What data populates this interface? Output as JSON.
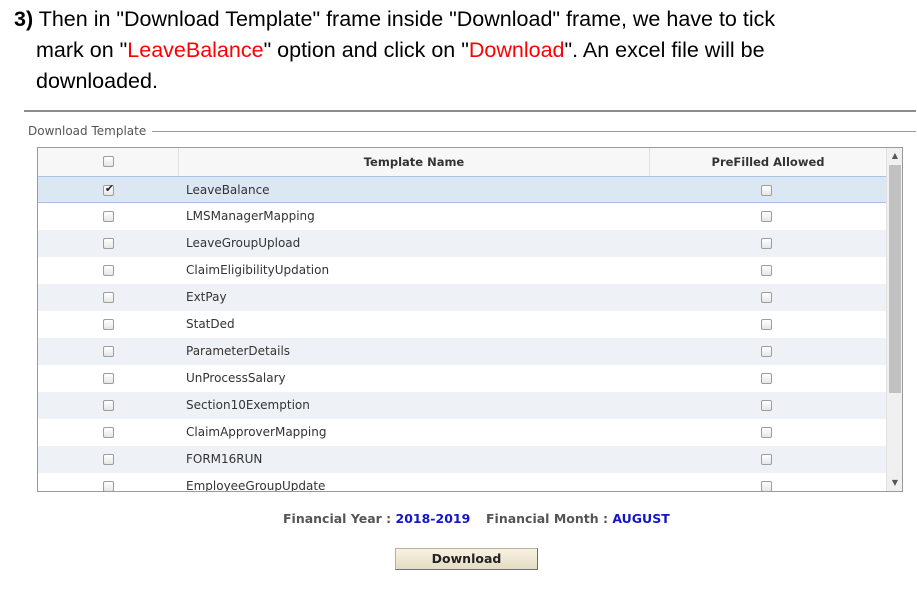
{
  "instruction": {
    "step_number": "3)",
    "line1": " Then in \"Download Template\" frame inside \"Download\" frame, we have to tick",
    "line2_a": "mark on \"",
    "line2_red1": "LeaveBalance",
    "line2_b": "\" option and click on \"",
    "line2_red2": "Download",
    "line2_c": "\". An excel file will be",
    "line3": "downloaded."
  },
  "frame": {
    "legend": "Download Template"
  },
  "table": {
    "header_template": "Template Name",
    "header_prefilled": "PreFilled Allowed",
    "rows": [
      {
        "name": "LeaveBalance",
        "checked": true,
        "prefilled": false
      },
      {
        "name": "LMSManagerMapping",
        "checked": false,
        "prefilled": false
      },
      {
        "name": "LeaveGroupUpload",
        "checked": false,
        "prefilled": false
      },
      {
        "name": "ClaimEligibilityUpdation",
        "checked": false,
        "prefilled": false
      },
      {
        "name": "ExtPay",
        "checked": false,
        "prefilled": false
      },
      {
        "name": "StatDed",
        "checked": false,
        "prefilled": false
      },
      {
        "name": "ParameterDetails",
        "checked": false,
        "prefilled": false
      },
      {
        "name": "UnProcessSalary",
        "checked": false,
        "prefilled": false
      },
      {
        "name": "Section10Exemption",
        "checked": false,
        "prefilled": false
      },
      {
        "name": "ClaimApproverMapping",
        "checked": false,
        "prefilled": false
      },
      {
        "name": "FORM16RUN",
        "checked": false,
        "prefilled": false
      },
      {
        "name": "EmployeeGroupUpdate",
        "checked": false,
        "prefilled": false
      }
    ]
  },
  "financial": {
    "year_label": "Financial Year :",
    "year_value": "2018-2019",
    "month_label": "Financial Month :",
    "month_value": "AUGUST"
  },
  "download_button": "Download",
  "colors": {
    "highlight_red": "#ff0000",
    "value_blue": "#1414c8",
    "selected_row": "#dce7f4",
    "alt_row": "#eef2f7"
  }
}
